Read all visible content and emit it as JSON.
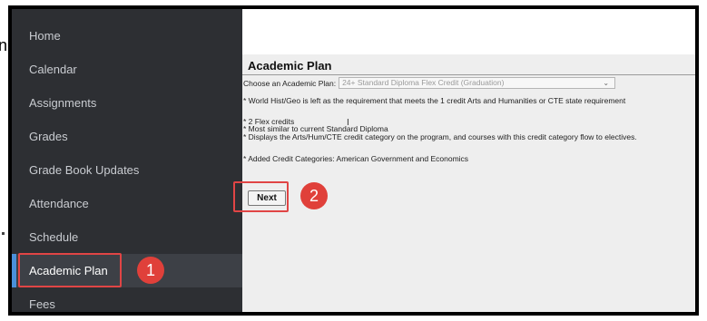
{
  "sidebar": {
    "items": [
      {
        "label": "Home"
      },
      {
        "label": "Calendar"
      },
      {
        "label": "Assignments"
      },
      {
        "label": "Grades"
      },
      {
        "label": "Grade Book Updates"
      },
      {
        "label": "Attendance"
      },
      {
        "label": "Schedule"
      },
      {
        "label": "Academic Plan",
        "active": true
      },
      {
        "label": "Fees"
      }
    ]
  },
  "main": {
    "title": "Academic Plan",
    "plan_label": "Choose an Academic Plan:",
    "plan_selected": "24+ Standard Diploma Flex Credit (Graduation)",
    "notes": [
      "* World Hist/Geo is left as the requirement that meets the 1 credit Arts and Humanities or CTE state requirement",
      "* 2 Flex credits",
      "* Most similar to current Standard Diploma",
      "* Displays the Arts/Hum/CTE credit category on the program, and courses with this credit category flow to electives.",
      "* Added Credit Categories: American Government and Economics"
    ],
    "next_label": "Next"
  },
  "annotations": {
    "step1": "1",
    "step2": "2",
    "highlight_color": "#e04545",
    "badge_color": "#e0403a"
  },
  "stray_text": "n"
}
